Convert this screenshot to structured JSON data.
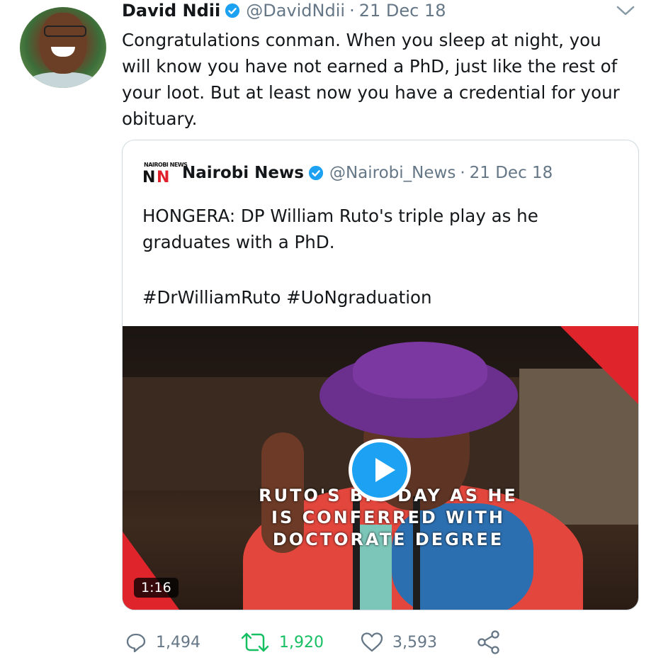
{
  "tweet": {
    "author_name": "David Ndii",
    "handle": "@DavidNdii",
    "separator": "·",
    "date": "21 Dec 18",
    "text": "Congratulations conman. When you sleep at night, you will know you have not earned a PhD, just like the rest of your loot. But at least now you have a credential for your obituary."
  },
  "quoted": {
    "logo_top_text": "NAIROBI NEWS",
    "logo_letters": [
      "N",
      "N"
    ],
    "author_name": "Nairobi News",
    "handle": "@Nairobi_News",
    "separator": "·",
    "date": "21 Dec 18",
    "text": "HONGERA: DP William Ruto's triple play as he graduates with a PhD.",
    "hashtags": "#DrWilliamRuto #UoNgraduation",
    "video": {
      "overlay_text": "RUTO'S BIG DAY AS HE IS CONFERRED WITH DOCTORATE DEGREE",
      "duration": "1:16"
    }
  },
  "actions": {
    "replies": "1,494",
    "retweets": "1,920",
    "likes": "3,593"
  },
  "colors": {
    "verified": "#1da1f2",
    "retweet_active": "#17bf63",
    "muted": "#657786",
    "play_button": "#1da1f2"
  },
  "icons": [
    "verified-badge-icon",
    "chevron-down-icon",
    "play-icon",
    "reply-icon",
    "retweet-icon",
    "like-icon",
    "share-icon"
  ]
}
